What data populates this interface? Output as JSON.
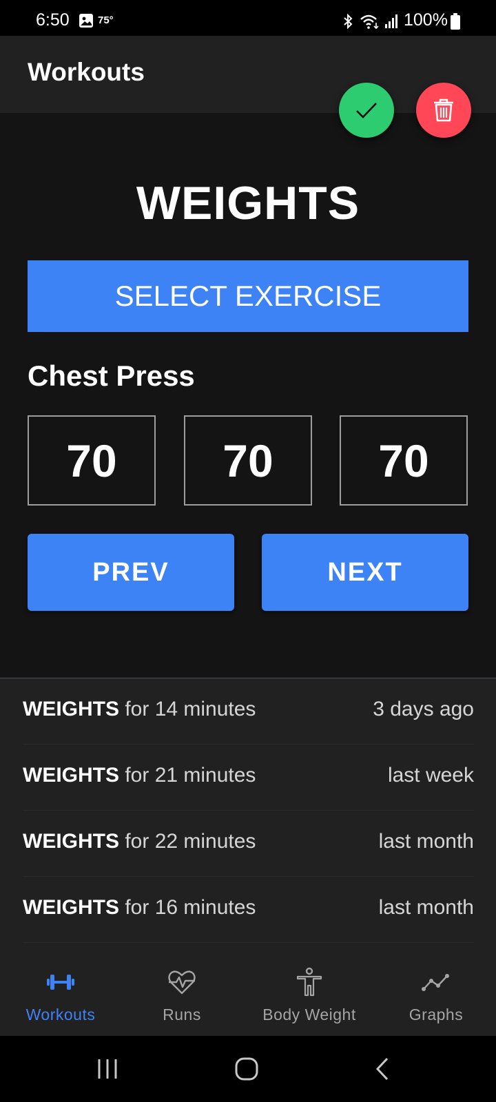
{
  "status_bar": {
    "time": "6:50",
    "temperature": "75°",
    "battery": "100%",
    "icons": [
      "gallery-icon",
      "bluetooth-icon",
      "wifi-icon",
      "signal-icon",
      "battery-icon"
    ]
  },
  "app_bar": {
    "title": "Workouts"
  },
  "fabs": {
    "confirm_icon": "check-icon",
    "delete_icon": "trash-icon",
    "confirm_color": "#2ecc71",
    "delete_color": "#ff4757"
  },
  "main": {
    "title": "WEIGHTS",
    "select_label": "SELECT EXERCISE",
    "exercise": "Chest Press",
    "sets": [
      "70",
      "70",
      "70"
    ],
    "prev_label": "PREV",
    "next_label": "NEXT"
  },
  "history": [
    {
      "type": "WEIGHTS",
      "duration": "for 14 minutes",
      "when": "3 days ago"
    },
    {
      "type": "WEIGHTS",
      "duration": "for 21 minutes",
      "when": "last week"
    },
    {
      "type": "WEIGHTS",
      "duration": "for 22 minutes",
      "when": "last month"
    },
    {
      "type": "WEIGHTS",
      "duration": "for 16 minutes",
      "when": "last month"
    }
  ],
  "bottom_nav": {
    "active": "Workouts",
    "tabs": [
      {
        "label": "Workouts",
        "icon": "dumbbell-icon"
      },
      {
        "label": "Runs",
        "icon": "heart-pulse-icon"
      },
      {
        "label": "Body Weight",
        "icon": "person-icon"
      },
      {
        "label": "Graphs",
        "icon": "line-graph-icon"
      }
    ]
  },
  "colors": {
    "accent": "#3d83f6",
    "success": "#2ecc71",
    "danger": "#ff4757",
    "background": "#141414",
    "surface": "#212121"
  }
}
